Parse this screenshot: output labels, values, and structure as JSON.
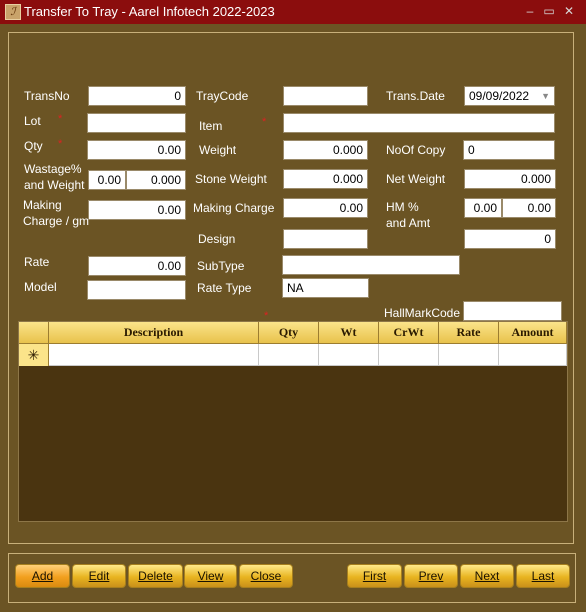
{
  "window": {
    "title": "Transfer To Tray - Aarel Infotech 2022-2023",
    "app_icon": "ℐ"
  },
  "form": {
    "transno_label": "TransNo",
    "transno_value": "0",
    "traycode_label": "TrayCode",
    "traycode_value": "",
    "transdate_label": "Trans.Date",
    "transdate_value": "09/09/2022",
    "lot_label": "Lot",
    "lot_value": "",
    "item_label": "Item",
    "item_value": "",
    "qty_label": "Qty",
    "qty_value": "0.00",
    "weight_label": "Weight",
    "weight_value": "0.000",
    "noofcopy_label": "NoOf Copy",
    "noofcopy_value": "0",
    "wastage_label_1": "Wastage%",
    "wastage_label_2": "and Weight",
    "wastage_pct_value": "0.00",
    "wastage_wt_value": "0.000",
    "stoneweight_label": "Stone Weight",
    "stoneweight_value": "0.000",
    "netweight_label": "Net Weight",
    "netweight_value": "0.000",
    "makingcharge_gm_label_1": "Making",
    "makingcharge_gm_label_2": "Charge / gm",
    "makingcharge_gm_value": "0.00",
    "makingcharge_label": "Making Charge",
    "makingcharge_value": "0.00",
    "hm_label_1": "HM %",
    "hm_label_2": "and Amt",
    "hm_pct_value": "0.00",
    "hm_amt_value": "0.00",
    "design_label": "Design",
    "design_value": "",
    "design_amount_value": "0",
    "rate_label": "Rate",
    "rate_value": "0.00",
    "subtype_label": "SubType",
    "subtype_value": "",
    "model_label": "Model",
    "model_value": "",
    "ratetype_label": "Rate Type",
    "ratetype_value": "NA",
    "hallmarkcode_label": "HallMarkCode",
    "hallmarkcode_value": "",
    "required_mark": "*"
  },
  "grid": {
    "columns": [
      "Description",
      "Qty",
      "Wt",
      "CrWt",
      "Rate",
      "Amount"
    ],
    "new_row_marker": "✳"
  },
  "buttons": {
    "add": "Add",
    "edit": "Edit",
    "delete": "Delete",
    "view": "View",
    "close": "Close",
    "first": "First",
    "prev": "Prev",
    "next": "Next",
    "last": "Last"
  },
  "colors": {
    "background": "#6b5424",
    "titlebar": "#8b0d0d",
    "button_gold": "#e8b420",
    "grid_header": "#fbe48a"
  }
}
